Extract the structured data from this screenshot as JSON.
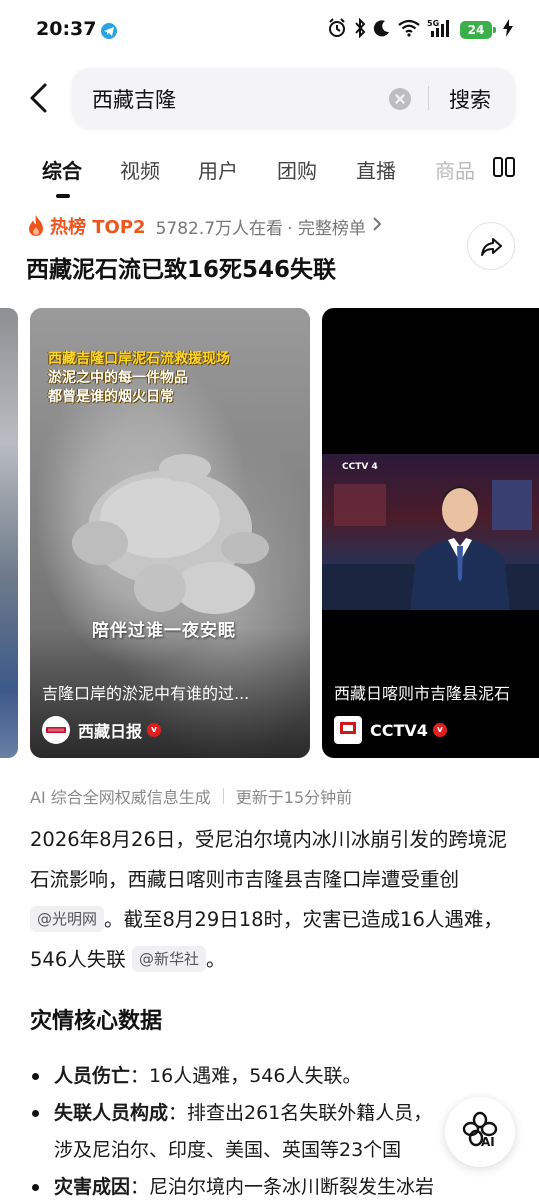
{
  "status_bar": {
    "time": "20:37",
    "battery": "24",
    "icons": [
      "telegram-icon",
      "alarm-icon",
      "bluetooth-icon",
      "moon-icon",
      "wifi-icon",
      "signal-5g-icon",
      "battery-icon",
      "charging-icon"
    ]
  },
  "search": {
    "query": "西藏吉隆",
    "submit_label": "搜索"
  },
  "tabs": [
    {
      "label": "综合",
      "active": true
    },
    {
      "label": "视频"
    },
    {
      "label": "用户"
    },
    {
      "label": "团购"
    },
    {
      "label": "直播"
    },
    {
      "label": "商品"
    }
  ],
  "hot": {
    "label": "热榜 TOP2",
    "count": "5782.7万人在看",
    "full_list": "· 完整榜单",
    "title": "西藏泥石流已致16死546失联"
  },
  "cards": [
    {
      "caption_lines": [
        "西藏吉隆口岸泥石流救援现场",
        "淤泥之中的每一件物品",
        "都曾是谁的烟火日常"
      ],
      "mid_text": "陪伴过谁一夜安眠",
      "headline": "吉隆口岸的淤泥中有谁的过...",
      "source": "西藏日报"
    },
    {
      "headline": "西藏日喀则市吉隆县泥石",
      "source": "CCTV4",
      "channel_mark": "CCTV 4"
    }
  ],
  "summary": {
    "source_note": "AI 综合全网权威信息生成",
    "updated": "更新于15分钟前",
    "para_part1": "2026年8月26日，受尼泊尔境内冰川冰崩引发的跨境泥石流影响，西藏日喀则市吉隆县吉隆口岸遭受重创",
    "cite1": "@光明网",
    "para_part2": "。截至8月29日18时，灾害已造成16人遇难，546人失联",
    "cite2": "@新华社",
    "para_part3": "。"
  },
  "section_title": "灾情核心数据",
  "bullets": [
    {
      "label": "人员伤亡",
      "text": "：16人遇难，546人失联。"
    },
    {
      "label": "失联人员构成",
      "text": "：排查出261名失联外籍人员，",
      "line2": "涉及尼泊尔、印度、美国、英国等23个国"
    },
    {
      "label": "灾害成因",
      "text": "：尼泊尔境内一条冰川断裂发生冰岩"
    }
  ],
  "ai_button": "AI"
}
